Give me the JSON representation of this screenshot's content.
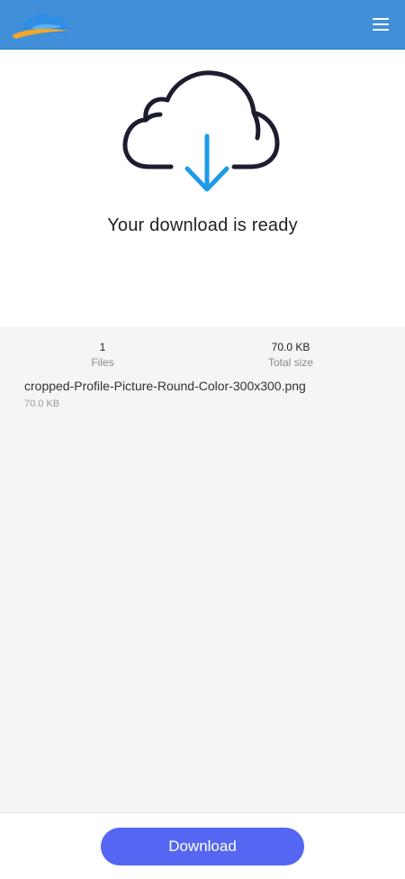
{
  "header": {
    "logo_icon": "cloud-logo-icon",
    "menu_icon": "hamburger-menu-icon",
    "background_color": "#418fd8"
  },
  "hero": {
    "icon": "cloud-download-icon",
    "title": "Your download is ready",
    "arrow_color": "#1e9be8"
  },
  "summary": {
    "files_count": "1",
    "files_label": "Files",
    "total_size": "70.0 KB",
    "total_size_label": "Total size"
  },
  "files": [
    {
      "name": "cropped-Profile-Picture-Round-Color-300x300.png",
      "size": "70.0 KB"
    }
  ],
  "footer": {
    "download_label": "Download",
    "button_color": "#5566f3"
  }
}
